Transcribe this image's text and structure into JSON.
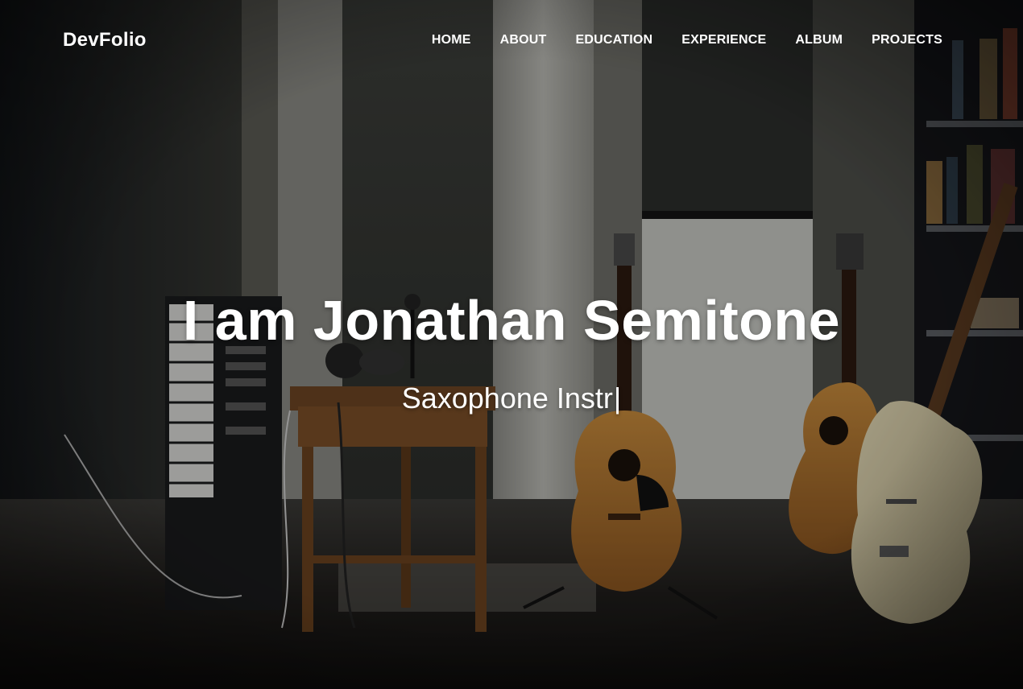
{
  "brand": {
    "name": "DevFolio"
  },
  "nav": {
    "items": [
      "HOME",
      "ABOUT",
      "EDUCATION",
      "EXPERIENCE",
      "ALBUM",
      "PROJECTS"
    ]
  },
  "hero": {
    "title": "I am Jonathan Semitone",
    "typed_text": "Saxophone Instr",
    "cursor": "|"
  },
  "colors": {
    "text": "#ffffff",
    "overlay": "#000000"
  }
}
